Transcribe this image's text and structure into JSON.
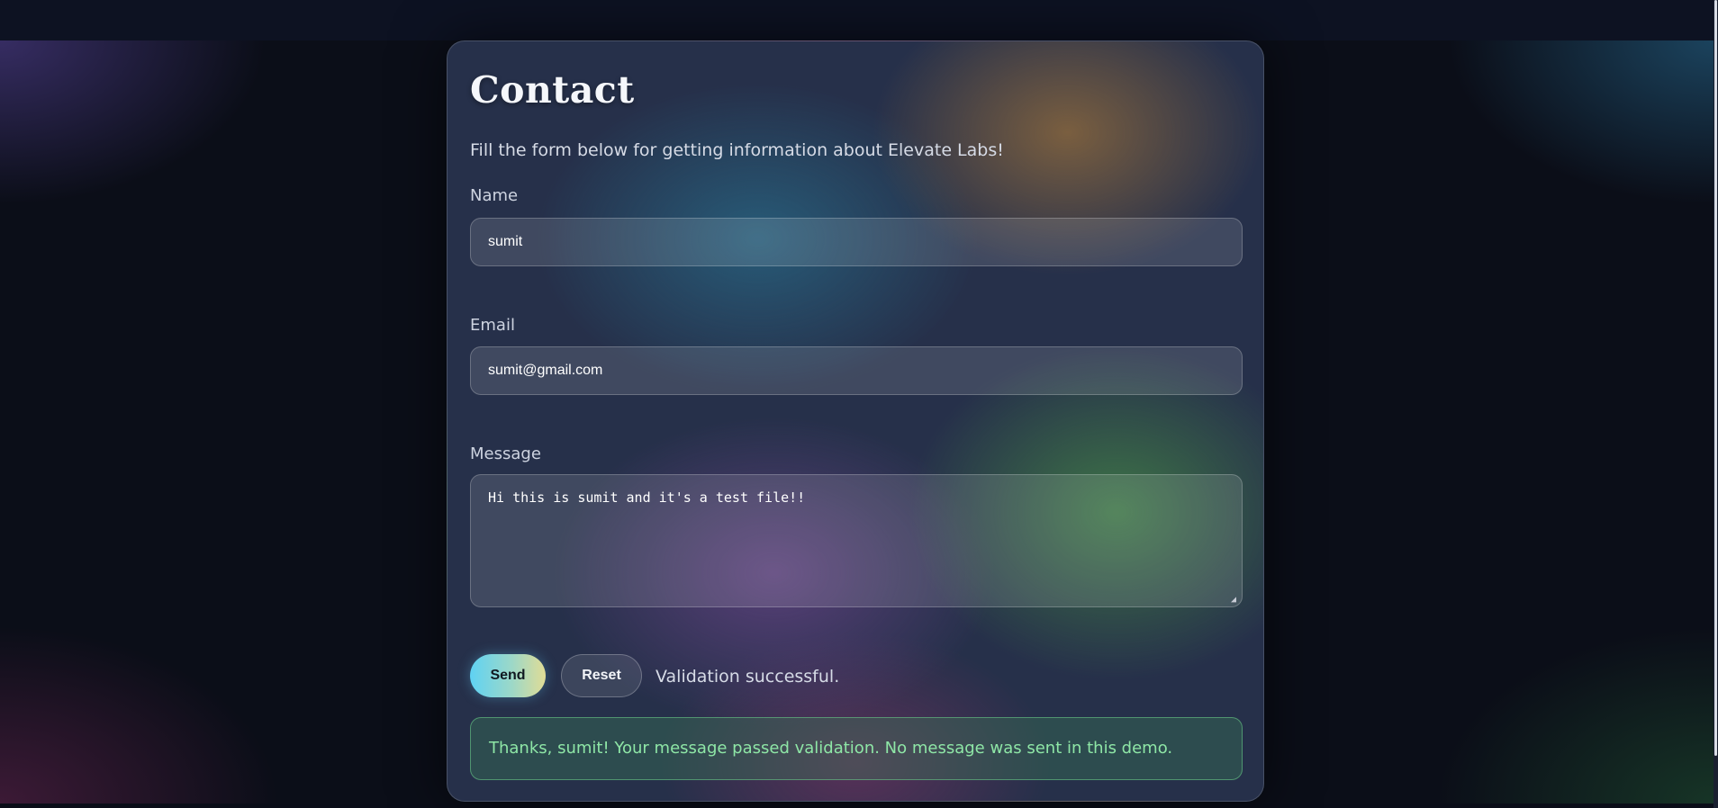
{
  "page": {
    "title": "Contact",
    "subtitle": "Fill the form below for getting information about Elevate Labs!"
  },
  "form": {
    "name_label": "Name",
    "name_value": "sumit",
    "email_label": "Email",
    "email_value": "sumit@gmail.com",
    "message_label": "Message",
    "message_value": "Hi this is sumit and it's a test file!!",
    "send_label": "Send",
    "reset_label": "Reset",
    "status_text": "Validation successful."
  },
  "alert": {
    "text": "Thanks, sumit! Your message passed validation. No message was sent in this demo."
  },
  "colors": {
    "background": "#0b0f1a",
    "success_text": "#8ee6a6",
    "send_gradient_start": "#5fd2f3",
    "send_gradient_end": "#e0dc96"
  }
}
